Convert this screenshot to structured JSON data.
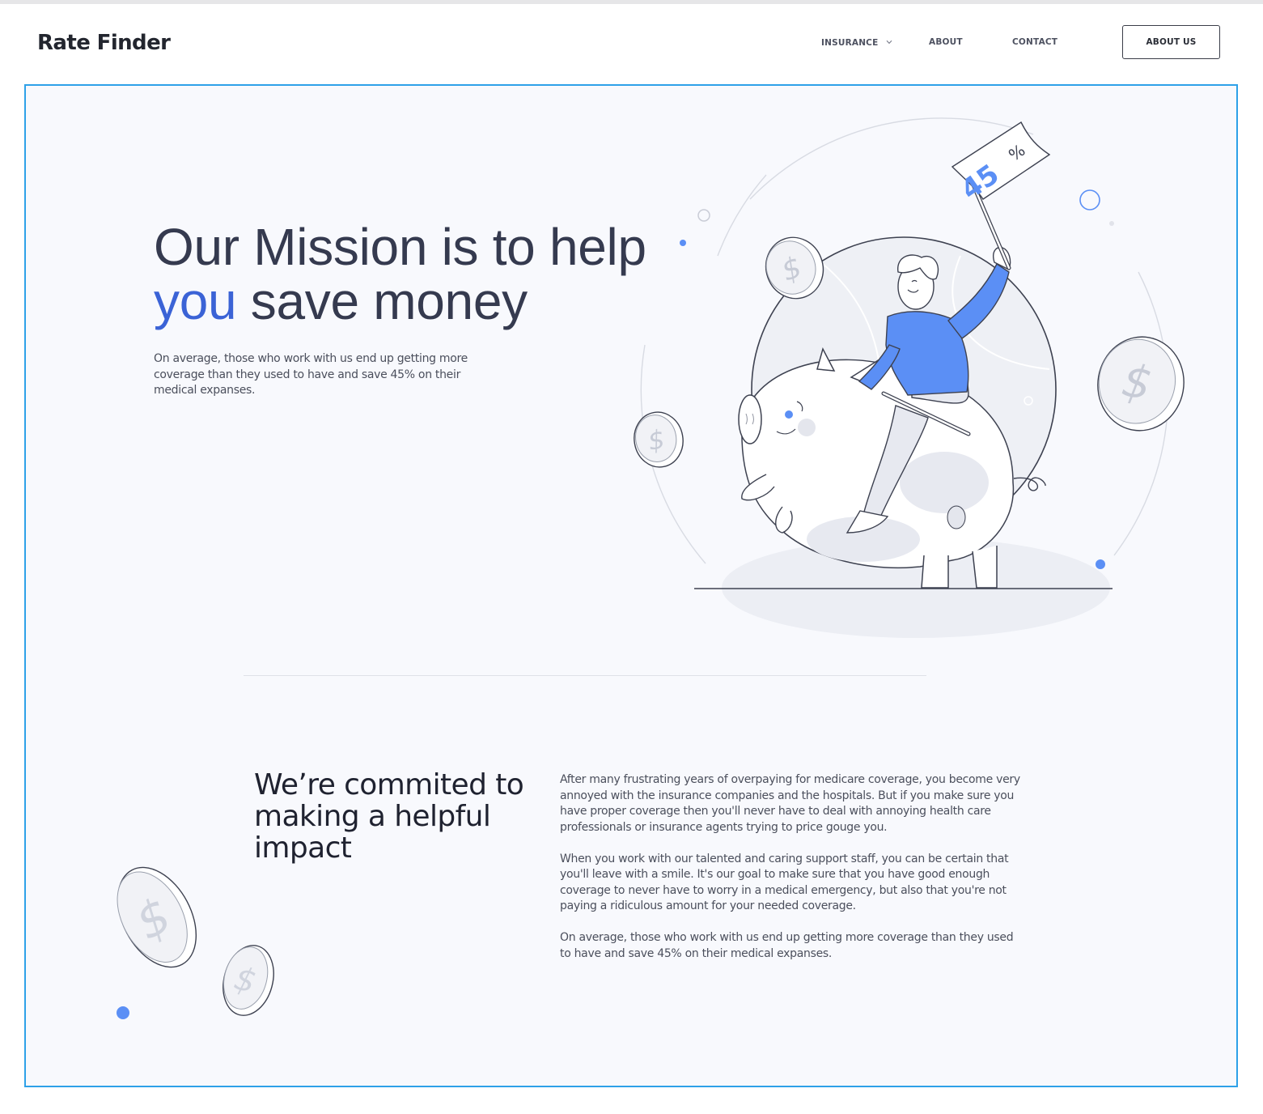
{
  "brand": {
    "name": "Rate Finder"
  },
  "nav": {
    "items": [
      {
        "label": "INSURANCE",
        "has_dropdown": true,
        "icon": "chevron-down-icon"
      },
      {
        "label": "ABOUT"
      },
      {
        "label": "CONTACT"
      }
    ],
    "cta_label": "ABOUT US"
  },
  "hero": {
    "title_line1": "Our Mission is to help",
    "title_accent": "you",
    "title_rest": " save money",
    "text": "On average, those who work with us end up getting more coverage than they used to have and save 45% on their medical expanses.",
    "flag_number": "45",
    "flag_symbol": "%",
    "coin_symbol": "$"
  },
  "commitment": {
    "title": "We’re commited to making a helpful impact",
    "paragraphs": [
      "After many frustrating years of overpaying for medicare coverage, you become very annoyed with the insurance companies and the hospitals. But if you make sure you have proper coverage then you'll never have to deal with annoying health care professionals or insurance agents trying to price gouge you.",
      "When you work with our talented and caring support staff, you can be certain that you'll leave with a smile. It's our goal to make sure that you have good enough coverage to never have to worry in a medical emergency, but also that you're not paying a ridiculous amount for your needed coverage.",
      "On average, those who work with us end up getting more coverage than they used to have and save 45% on their medical expanses."
    ]
  },
  "colors": {
    "accent": "#3b63d6",
    "illustration_blue": "#5b8ff5",
    "frame_border": "#2ea1e8",
    "frame_bg": "#f8f9fd"
  }
}
